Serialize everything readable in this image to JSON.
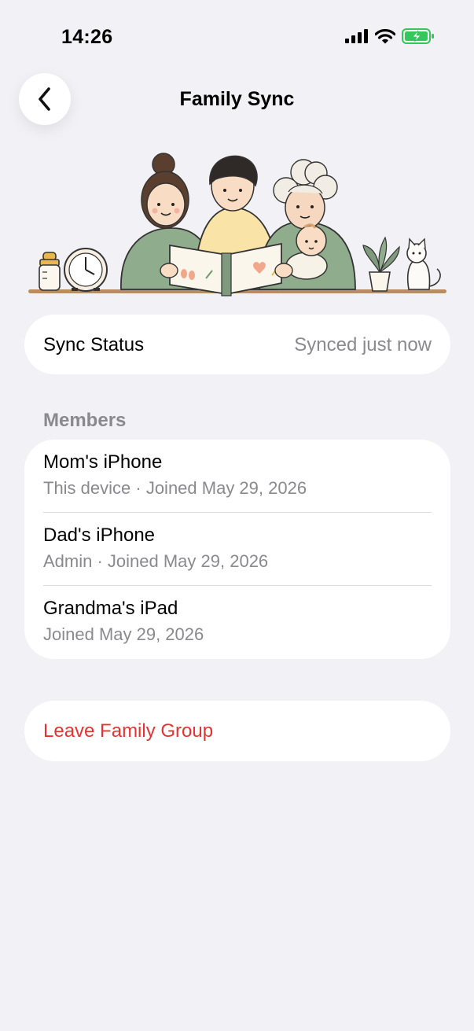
{
  "status_bar": {
    "time": "14:26",
    "icons": [
      "signal-icon",
      "wifi-icon",
      "battery-charging-icon"
    ]
  },
  "nav": {
    "title": "Family Sync",
    "back_icon": "chevron-left-icon"
  },
  "sync": {
    "label": "Sync Status",
    "value": "Synced just now"
  },
  "members": {
    "header": "Members",
    "items": [
      {
        "name": "Mom's iPhone",
        "detail": "This device · Joined May 29, 2026"
      },
      {
        "name": "Dad's iPhone",
        "detail": "Admin · Joined May 29, 2026"
      },
      {
        "name": "Grandma's iPad",
        "detail": "Joined May 29, 2026"
      }
    ]
  },
  "actions": {
    "leave_label": "Leave Family Group"
  },
  "colors": {
    "background": "#f1f1f6",
    "destructive": "#e5342f",
    "secondary_text": "#8a8a8e",
    "battery": "#34c759"
  }
}
